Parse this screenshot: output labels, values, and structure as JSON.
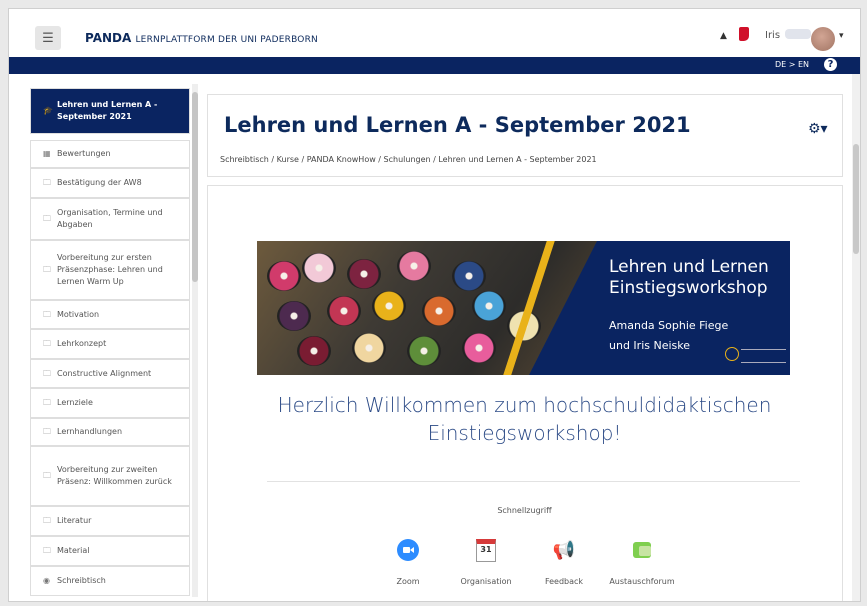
{
  "header": {
    "menu_icon": "hamburger-icon",
    "brand_name": "PANDA",
    "brand_sub": "LERNPLATTFORM DER UNI PADERBORN",
    "bell_icon": "bell-icon",
    "messages_icon": "chat-icon",
    "user_name": "Iris",
    "caret": "▾"
  },
  "langbar": {
    "lang_switch": "DE > EN",
    "help_icon": "question-circle-icon",
    "help_glyph": "?"
  },
  "sidebar": {
    "items": [
      {
        "label": "Lehren und Lernen A - September 2021",
        "icon": "graduation-cap-icon",
        "glyph": "🎓",
        "active": true
      },
      {
        "label": "Bewertungen",
        "icon": "table-icon",
        "glyph": "▦"
      },
      {
        "label": "Bestätigung der AW8",
        "icon": "folder-icon",
        "glyph": "🗀"
      },
      {
        "label": "Organisation, Termine und Abgaben",
        "icon": "folder-icon",
        "glyph": "🗀"
      },
      {
        "label": "Vorbereitung zur ersten Präsenzphase: Lehren und Lernen Warm Up",
        "icon": "folder-icon",
        "glyph": "🗀"
      },
      {
        "label": "Motivation",
        "icon": "folder-icon",
        "glyph": "🗀"
      },
      {
        "label": "Lehrkonzept",
        "icon": "folder-icon",
        "glyph": "🗀"
      },
      {
        "label": "Constructive Alignment",
        "icon": "folder-icon",
        "glyph": "🗀"
      },
      {
        "label": "Lernziele",
        "icon": "folder-icon",
        "glyph": "🗀"
      },
      {
        "label": "Lernhandlungen",
        "icon": "folder-icon",
        "glyph": "🗀"
      },
      {
        "label": "Vorbereitung zur zweiten Präsenz: Willkommen zurück",
        "icon": "folder-icon",
        "glyph": "🗀"
      },
      {
        "label": "Literatur",
        "icon": "folder-icon",
        "glyph": "🗀"
      },
      {
        "label": "Material",
        "icon": "folder-icon",
        "glyph": "🗀"
      },
      {
        "label": "Schreibtisch",
        "icon": "tachometer-icon",
        "glyph": "◉"
      }
    ]
  },
  "course": {
    "title": "Lehren und Lernen A - September 2021",
    "breadcrumb": "Schreibtisch / Kurse / PANDA KnowHow / Schulungen / Lehren und Lernen A - September 2021",
    "gear_icon": "gear-icon",
    "gear_glyph": "⚙▾"
  },
  "banner": {
    "title": "Lehren und Lernen\nEinstiegsworkshop",
    "authors": "Amanda Sophie Fiege\nund  Iris Neiske"
  },
  "welcome": "Herzlich Willkommen zum hochschuldidaktischen Einstiegsworkshop!",
  "quick_access": {
    "label": "Schnellzugriff",
    "items": [
      {
        "label": "Zoom",
        "icon": "zoom-icon"
      },
      {
        "label": "Organisation",
        "icon": "calendar-icon",
        "glyph": "31"
      },
      {
        "label": "Feedback",
        "icon": "megaphone-icon",
        "glyph": "📢"
      },
      {
        "label": "Austauschforum",
        "icon": "forum-icon"
      }
    ]
  },
  "colors": {
    "navy": "#0a2461",
    "accent_yellow": "#e9b21a",
    "link_blue": "#2b4a86"
  }
}
